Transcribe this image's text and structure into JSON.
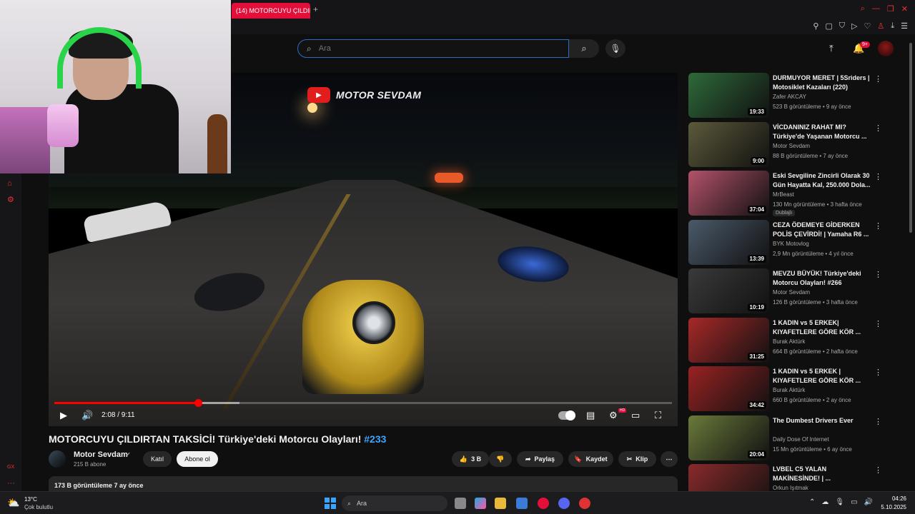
{
  "browser": {
    "tab_title": "(14) MOTORCUYU ÇILDIR",
    "new_tab_glyph": "+"
  },
  "search": {
    "placeholder": "Ara",
    "icon": "search-icon"
  },
  "header": {
    "notification_badge": "9+"
  },
  "player": {
    "watermark": "MOTOR SEVDAM",
    "current_time": "2:08",
    "duration": "9:11",
    "time_text": "2:08 / 9:11",
    "progress_fraction": 0.233,
    "buffer_fraction": 0.3,
    "hd_badge": "HD"
  },
  "video": {
    "title": "MOTORCUYU ÇILDIRTAN TAKSİCİ! Türkiye'deki Motorcu Olayları!",
    "hashtag": "#233",
    "channel_name": "Motor Sevdam",
    "subscribers": "215 B abone",
    "join_label": "Katıl",
    "subscribe_label": "Abone ol",
    "likes": "3 B",
    "share_label": "Paylaş",
    "save_label": "Kaydet",
    "clip_label": "Klip",
    "description_summary": "173 B görüntüleme  7 ay önce"
  },
  "recommendations": [
    {
      "title": "DURMUYOR MERET | 5Sriders | Motosiklet Kazaları (220)",
      "channel": "Zafer AKCAY",
      "meta": "523 B görüntüleme • 9 ay önce",
      "duration": "19:33",
      "thumb_color": "#2f6a3a"
    },
    {
      "title": "VİCDANINIZ RAHAT MI? Türkiye'de Yaşanan Motorcu ...",
      "channel": "Motor Sevdam",
      "meta": "88 B görüntüleme • 7 ay önce",
      "duration": "9:00",
      "thumb_color": "#5c5a3a"
    },
    {
      "title": "Eski Sevgiline Zincirli Olarak 30 Gün Hayatta Kal, 250.000 Dola...",
      "channel": "MrBeast",
      "meta": "130 Mn görüntüleme • 3 hafta önce",
      "duration": "37:04",
      "thumb_color": "#b3526a",
      "dubbed": "Dublajlı"
    },
    {
      "title": "CEZA ÖDEMEYE GİDERKEN POLİS ÇEVİRDİ! | Yamaha R6 ...",
      "channel": "BYK Motovlog",
      "meta": "2,9 Mn görüntüleme • 4 yıl önce",
      "duration": "13:39",
      "thumb_color": "#4a5a6a"
    },
    {
      "title": "MEVZU BÜYÜK! Türkiye'deki Motorcu Olayları! #266",
      "channel": "Motor Sevdam",
      "meta": "126 B görüntüleme • 3 hafta önce",
      "duration": "10:19",
      "thumb_color": "#3a3a3a"
    },
    {
      "title": "1 KADIN vs 5 ERKEK| KIYAFETLERE GÖRE KÖR ...",
      "channel": "Burak Aktürk",
      "meta": "664 B görüntüleme • 2 hafta önce",
      "duration": "31:25",
      "thumb_color": "#a82828"
    },
    {
      "title": "1 KADIN vs 5 ERKEK | KIYAFETLERE GÖRE KÖR ...",
      "channel": "Burak Aktürk",
      "meta": "660 B görüntüleme • 2 ay önce",
      "duration": "34:42",
      "thumb_color": "#9a2222"
    },
    {
      "title": "The Dumbest Drivers Ever",
      "channel": "Daily Dose Of Internet",
      "meta": "15 Mn görüntüleme • 6 ay önce",
      "duration": "20:04",
      "thumb_color": "#6a7a3a"
    },
    {
      "title": "LVBEL C5 YALAN MAKİNESİNDE! | ...",
      "channel": "Orkun Işıtmak",
      "meta": "",
      "duration": "",
      "thumb_color": "#8a2a2a"
    }
  ],
  "taskbar": {
    "temperature": "13°C",
    "condition": "Çok bulutlu",
    "search_label": "Ara",
    "time": "04:26",
    "date": "5.10.2025"
  },
  "colors": {
    "accent_red": "#e10f3a",
    "progress_red": "#ff0000",
    "link_blue": "#3ea6ff",
    "bg": "#0f0f0f"
  }
}
